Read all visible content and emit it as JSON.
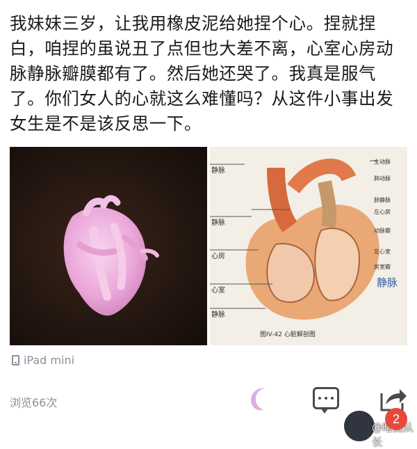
{
  "post": {
    "text": "我妹妹三岁，让我用橡皮泥给她捏个心。捏就捏白，咱捏的虽说丑了点但也大差不离，心室心房动脉静脉瓣膜都有了。然后她还哭了。我真是服气了。你们女人的心就这么难懂吗？从这件小事出发女生是不是该反思一下。"
  },
  "images": {
    "left": {
      "alt_icon": "clay-heart-photo"
    },
    "right": {
      "caption": "图IV-42  心脏解剖图",
      "labels_left": [
        "静脉",
        "静脉",
        "心房",
        "心室",
        "静脉"
      ],
      "labels_right": [
        "主动脉",
        "肺动脉",
        "肺静脉",
        "左心房",
        "动脉瓣",
        "左心室",
        "房室瓣"
      ],
      "handwritten": "静脉"
    }
  },
  "device": {
    "label": "iPad mini"
  },
  "footer": {
    "views": "浏览66次"
  },
  "badge": {
    "count": "2"
  },
  "watermark": {
    "text": "@暗挺队长"
  },
  "colors": {
    "moon": "#f2a2c8",
    "badge": "#e8483a",
    "muted": "#8a8f99"
  }
}
